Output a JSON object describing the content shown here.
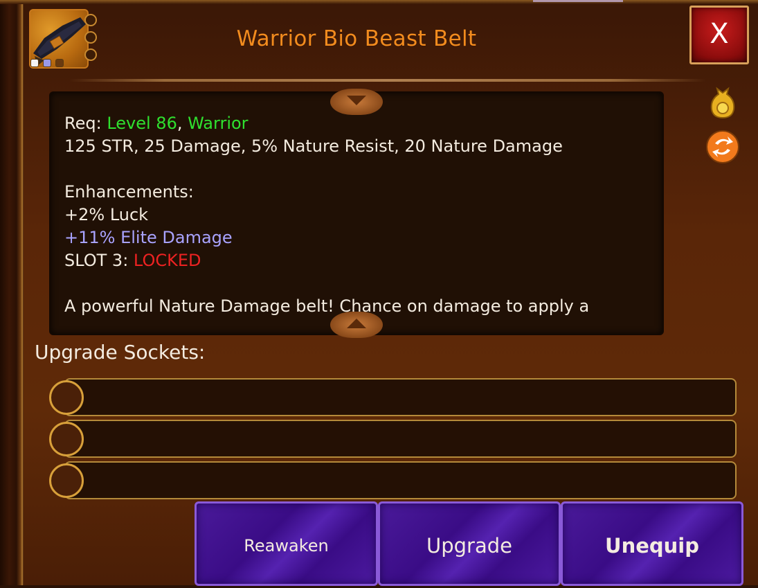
{
  "item": {
    "title": "Warrior Bio Beast Belt",
    "icon_name": "beast-belt-icon"
  },
  "header": {
    "close_label": "X"
  },
  "description": {
    "req_label": "Req: ",
    "req_level": "Level 86",
    "req_separator": ", ",
    "req_class": "Warrior",
    "stats": "125 STR, 25 Damage, 5% Nature Resist, 20 Nature Damage",
    "enhancements_label": "Enhancements:",
    "enhancement_1": "+2% Luck",
    "enhancement_2": "+11% Elite Damage",
    "slot3_label": "SLOT 3: ",
    "slot3_value": "LOCKED",
    "flavor": "A powerful Nature Damage belt! Chance on damage to apply a"
  },
  "side_icons": [
    "gold-bag-icon",
    "swap-icon"
  ],
  "sockets": {
    "label": "Upgrade Sockets:",
    "count": 3
  },
  "buttons": {
    "reawaken": "Reawaken",
    "upgrade": "Upgrade",
    "unequip": "Unequip"
  },
  "colors": {
    "title": "#f28c1e",
    "requirement": "#2fe02f",
    "enhancement_rare": "#a9a3ff",
    "locked": "#ee2222",
    "button_purple": "#3a0c86",
    "close_red": "#c81c1c"
  }
}
